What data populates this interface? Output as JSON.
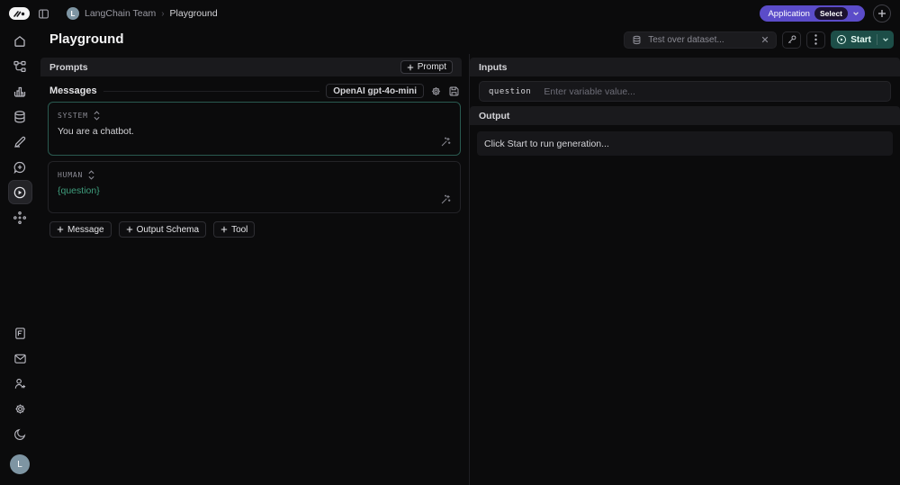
{
  "topbar": {
    "team_initial": "L",
    "team": "LangChain Team",
    "sep": "›",
    "page": "Playground",
    "application_label": "Application",
    "select_label": "Select"
  },
  "header": {
    "title": "Playground",
    "dataset_placeholder": "Test over dataset...",
    "start_label": "Start"
  },
  "sidebar": {
    "icons_top": [
      "home",
      "workflow",
      "monitoring",
      "datasets",
      "annotate",
      "chat-add",
      "playground",
      "deployments"
    ],
    "icons_bottom": [
      "docs",
      "mail",
      "invite-user",
      "settings",
      "dark-mode"
    ],
    "avatar_initial": "L"
  },
  "left_panel": {
    "prompts_header": "Prompts",
    "add_prompt_label": "Prompt",
    "messages_title": "Messages",
    "model_chip": "OpenAI gpt-4o-mini",
    "messages": [
      {
        "role": "SYSTEM",
        "content": "You are a chatbot."
      },
      {
        "role": "HUMAN",
        "content": "{question}"
      }
    ],
    "footer_buttons": {
      "message": "Message",
      "output_schema": "Output Schema",
      "tool": "Tool"
    }
  },
  "right_panel": {
    "inputs_header": "Inputs",
    "variable_name": "question",
    "variable_placeholder": "Enter variable value...",
    "output_header": "Output",
    "output_placeholder": "Click Start to run generation..."
  },
  "colors": {
    "accent_purple": "#5b4cc9",
    "start_teal": "#1d4e48",
    "variable_green": "#3f9e7d",
    "system_border": "#2a5a50"
  }
}
